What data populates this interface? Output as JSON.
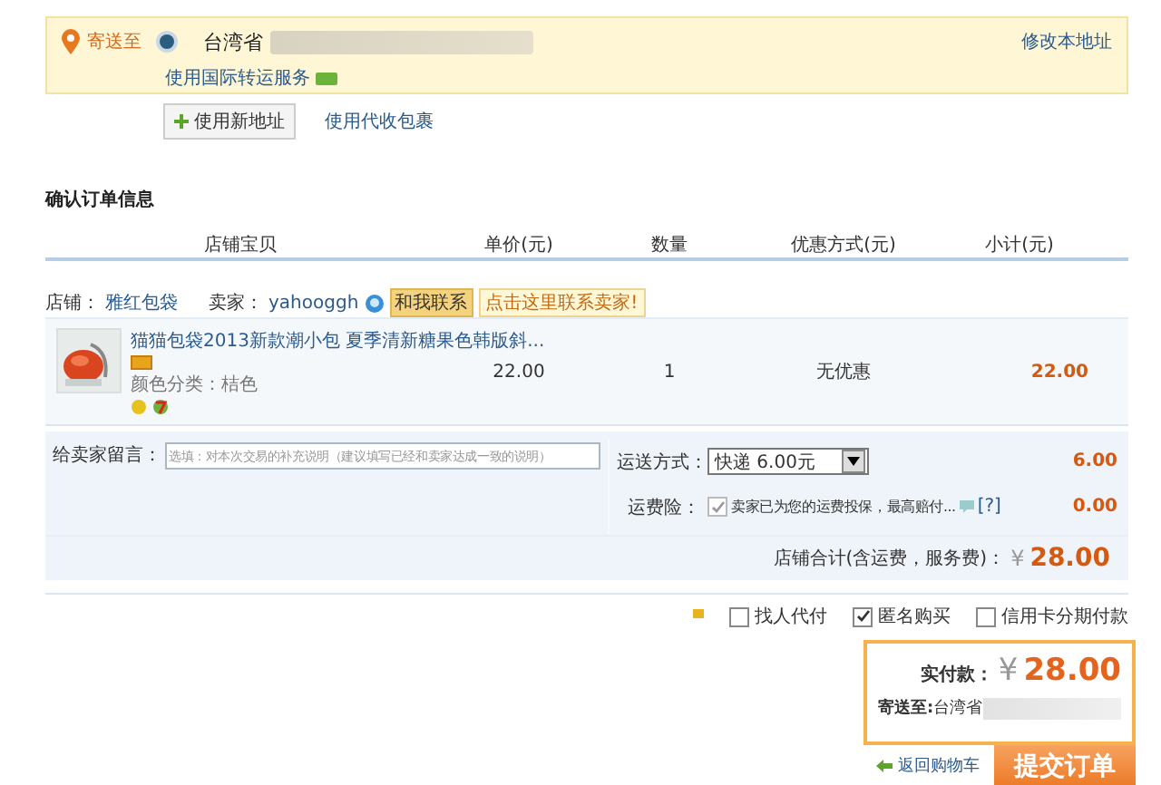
{
  "address": {
    "label": "寄送至",
    "selected": true,
    "province": "台湾省",
    "service_link": "使用国际转运服务",
    "modify_link": "修改本地址"
  },
  "address_actions": {
    "new_address_button": "使用新地址",
    "collect_link": "使用代收包裹"
  },
  "section_title": "确认订单信息",
  "table": {
    "columns": [
      "店铺宝贝",
      "单价(元)",
      "数量",
      "优惠方式(元)",
      "小计(元)"
    ]
  },
  "shop": {
    "label": "店铺：",
    "name": "雅红包袋",
    "seller_label": "卖家：",
    "seller": "yahooggh",
    "contact_badge": "和我联系",
    "contact_tip": "点击这里联系卖家!"
  },
  "item": {
    "title": "猫猫包袋2013新款潮小包 夏季清新糖果色韩版斜...",
    "spec": "颜色分类：桔色",
    "price": "22.00",
    "quantity": "1",
    "discount": "无优惠",
    "subtotal": "22.00"
  },
  "message": {
    "label": "给卖家留言：",
    "placeholder": "选填：对本次交易的补充说明（建议填写已经和卖家达成一致的说明）"
  },
  "shipping": {
    "label": "运送方式：",
    "value": "快递 6.00元",
    "amount": "6.00"
  },
  "insurance": {
    "label": "运费险：",
    "checked": true,
    "text": "卖家已为您的运费投保，最高赔付...",
    "help": "[?]",
    "amount": "0.00"
  },
  "shop_total": {
    "label": "店铺合计(含运费，服务费)：",
    "currency": "¥",
    "amount": "28.00"
  },
  "options": [
    {
      "label": "找人代付",
      "checked": false
    },
    {
      "label": "匿名购买",
      "checked": true
    },
    {
      "label": "信用卡分期付款",
      "checked": false
    }
  ],
  "summary": {
    "label": "实付款：",
    "currency": "¥",
    "amount": "28.00",
    "ship_label": "寄送至:",
    "ship_value": "台湾省"
  },
  "back_link": "返回购物车",
  "submit": "提交订单"
}
